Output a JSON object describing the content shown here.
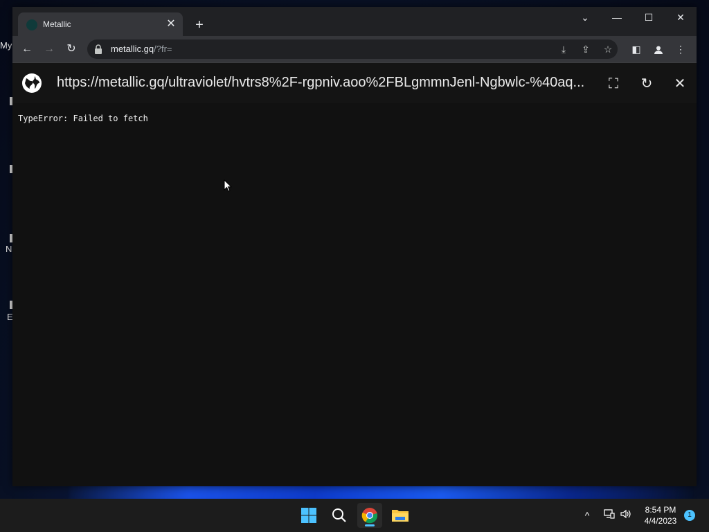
{
  "desktop": {
    "icon_labels": [
      "My",
      "N",
      "E"
    ]
  },
  "browser": {
    "tab": {
      "title": "Metallic",
      "close_glyph": "✕"
    },
    "new_tab_glyph": "+",
    "window_controls": {
      "tabsearch": "⌄",
      "minimize": "—",
      "maximize": "☐",
      "close": "✕"
    },
    "toolbar": {
      "back": "←",
      "forward": "→",
      "reload": "↻",
      "url_host": "metallic.gq",
      "url_rest": "/?fr=",
      "right_icons": [
        "install-icon",
        "share-icon",
        "bookmark-star-icon",
        "side-panel-icon",
        "profile-icon",
        "menu-icon"
      ]
    }
  },
  "page": {
    "proxy_url": "https://metallic.gq/ultraviolet/hvtrs8%2F-rgpniv.aoo%2FBLgmmnJenl-Ngbwlc-%40aq...",
    "fullscreen_glyph": "⛶",
    "reload_glyph": "↻",
    "close_glyph": "✕",
    "error_message": "TypeError: Failed to fetch"
  },
  "taskbar": {
    "apps": [
      "start-icon",
      "search-icon",
      "chrome-icon",
      "file-explorer-icon"
    ],
    "tray": {
      "chevron": "^"
    },
    "clock_time": "8:54 PM",
    "clock_date": "4/4/2023",
    "notification_count": "1"
  },
  "colors": {
    "accent": "#4cc2ff",
    "page_bg": "#111111",
    "chrome_frame": "#202124",
    "chrome_toolbar": "#35363a"
  }
}
